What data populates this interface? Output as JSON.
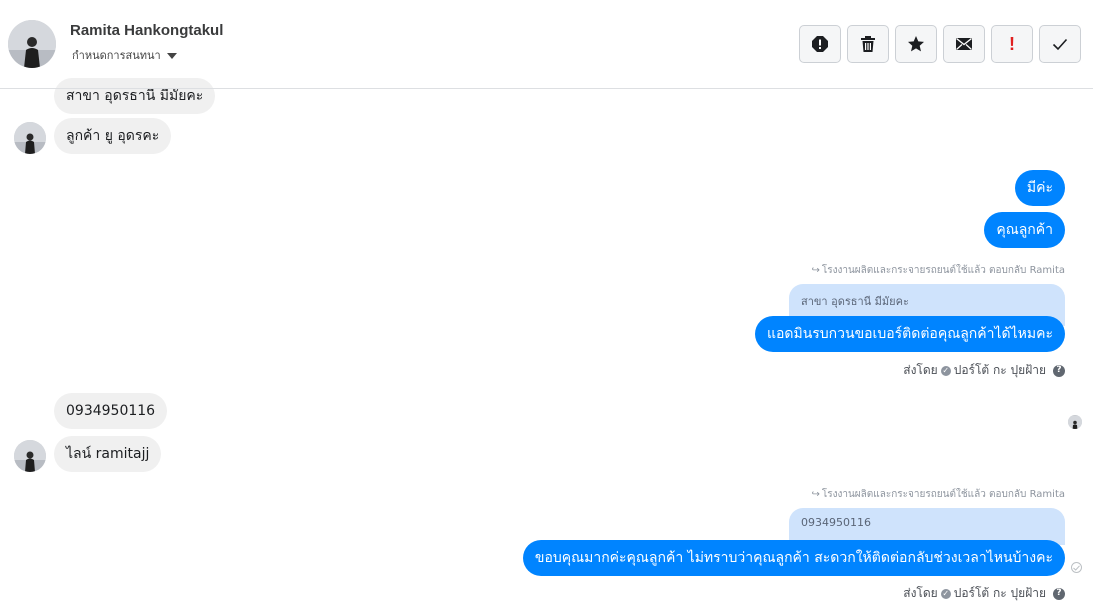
{
  "header": {
    "contact_name": "Ramita Hankongtakul",
    "assign_label": "กำหนดการสนทนา"
  },
  "toolbar": {
    "buttons": [
      {
        "icon": "report-icon"
      },
      {
        "icon": "trash-icon"
      },
      {
        "icon": "star-icon"
      },
      {
        "icon": "envelope-icon"
      },
      {
        "icon": "exclamation-icon",
        "glyph": "!"
      },
      {
        "icon": "checkmark-icon"
      }
    ]
  },
  "messages": {
    "m1": "สาขา อุดรธานี มีมัยคะ",
    "m2": "ลูกค้า ยู อุดรคะ",
    "m3": "มีค่ะ",
    "m4": "คุณลูกค้า",
    "reply_note_1": "โรงงานผลิตและกระจายรถยนต์ใช้แล้ว ตอบกลับ Ramita",
    "quote_1": "สาขา อุดรธานี มีมัยคะ",
    "m5": "แอดมินรบกวนขอเบอร์ติดต่อคุณลูกค้าได้ไหมคะ",
    "sent_by_1": "ส่งโดย",
    "sender_1": "ปอร์โต้ กะ ปุยฝ้าย",
    "m6": "0934950116",
    "m7": "ไลน์ ramitajj",
    "reply_note_2": "โรงงานผลิตและกระจายรถยนต์ใช้แล้ว ตอบกลับ Ramita",
    "quote_2": "0934950116",
    "m8": "ขอบคุณมากค่ะคุณลูกค้า ไม่ทราบว่าคุณลูกค้า สะดวกให้ติดต่อกลับช่วงเวลาไหนบ้างคะ",
    "sent_by_2": "ส่งโดย",
    "sender_2": "ปอร์โต้ กะ ปุยฝ้าย",
    "help_glyph": "?"
  },
  "colors": {
    "outgoing_bubble": "#0084ff",
    "incoming_bubble": "#f0f0f0",
    "quote_bg": "#cfe3fc",
    "alert_red": "#e02020"
  }
}
